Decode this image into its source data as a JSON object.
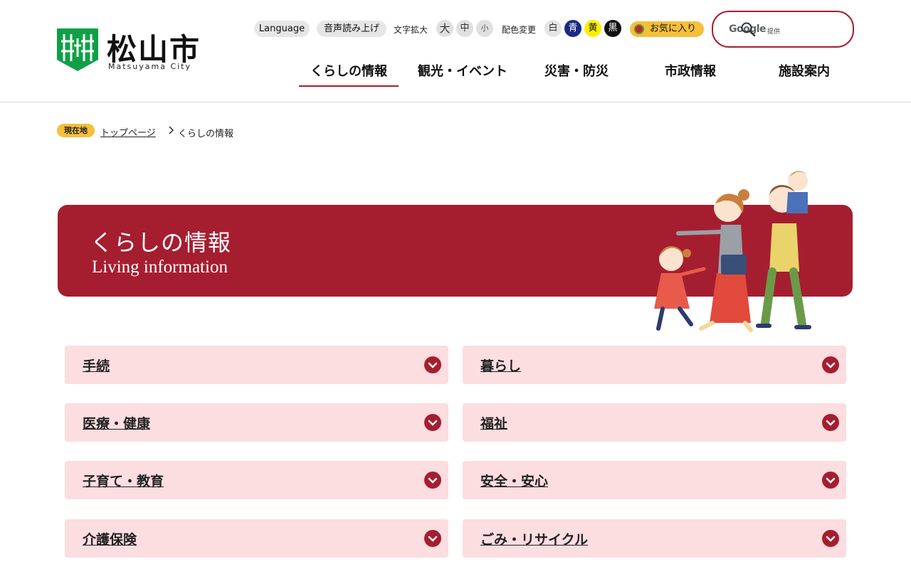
{
  "logo": {
    "name": "松山市",
    "sub": "Matsuyama City"
  },
  "utility": {
    "language": "Language",
    "read_aloud": "音声読み上げ",
    "text_size_label": "文字拡大",
    "sizes": [
      "大",
      "中",
      "小"
    ],
    "color_label": "配色変更",
    "colors": [
      {
        "label": "白",
        "bg": "#e6e6e6",
        "fg": "#333333"
      },
      {
        "label": "青",
        "bg": "#1a2a80",
        "fg": "#ffffff"
      },
      {
        "label": "黄",
        "bg": "#ffee00",
        "fg": "#111111"
      },
      {
        "label": "黒",
        "bg": "#111111",
        "fg": "#ffffff"
      }
    ],
    "favorites": "お気に入り"
  },
  "search": {
    "brand": "Google",
    "provided": "提供",
    "placeholder": ""
  },
  "nav": [
    "くらしの情報",
    "観光・イベント",
    "災害・防災",
    "市政情報",
    "施設案内"
  ],
  "breadcrumb": {
    "badge": "現在地",
    "home": "トップページ",
    "current": "くらしの情報"
  },
  "banner": {
    "title": "くらしの情報",
    "subtitle": "Living information"
  },
  "categories": [
    "手続",
    "暮らし",
    "医療・健康",
    "福祉",
    "子育て・教育",
    "安全・安心",
    "介護保険",
    "ごみ・リサイクル"
  ],
  "colors": {
    "accent": "#a51e30",
    "card_bg": "#fcdde0",
    "badge": "#f4bf3a",
    "logo_green": "#0fa047"
  }
}
